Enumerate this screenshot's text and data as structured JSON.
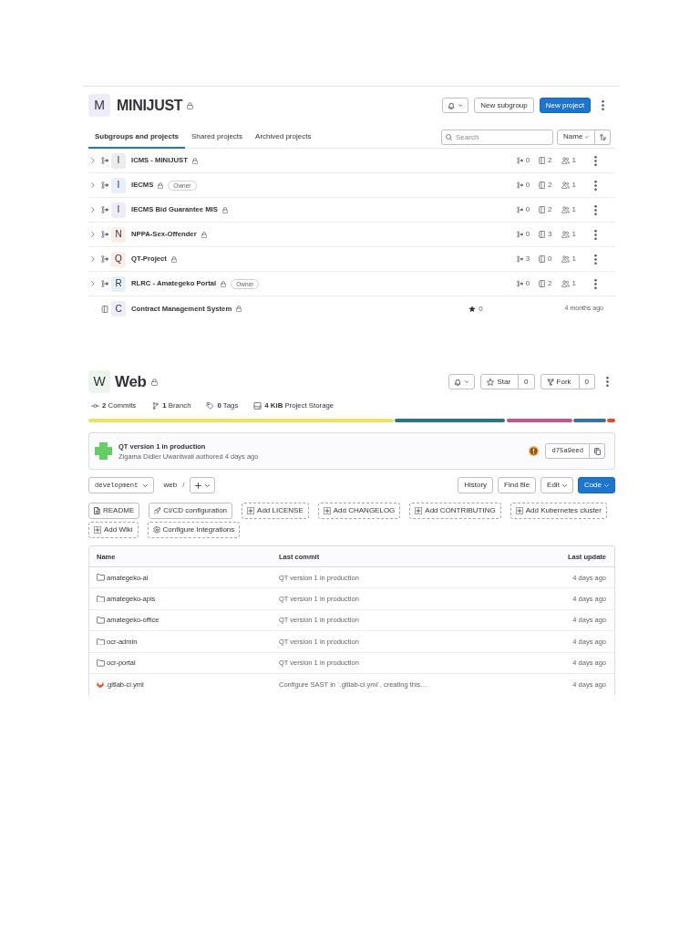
{
  "group": {
    "avatar": {
      "letter": "M",
      "color": "#eeecf8"
    },
    "name": "MINIJUST",
    "private": true,
    "buttons": [
      {
        "label": "New subgroup",
        "kind": "secondary"
      },
      {
        "label": "New project",
        "kind": "primary"
      }
    ],
    "tabs": [
      {
        "label": "Subgroups and projects",
        "selected": true
      },
      {
        "label": "Shared projects",
        "selected": false
      },
      {
        "label": "Archived projects",
        "selected": false
      }
    ],
    "search": {
      "placeholder": "Search"
    },
    "sort": {
      "label": "Name"
    },
    "items": [
      {
        "kind": "group",
        "letter": "I",
        "color": "#ececef",
        "name": "ICMS - MINIJUST",
        "private": true,
        "subgroups": "0",
        "projects": "2",
        "members": "1"
      },
      {
        "kind": "group",
        "letter": "I",
        "color": "#e6effa",
        "name": "IECMS",
        "private": true,
        "badge": "Owner",
        "subgroups": "0",
        "projects": "2",
        "members": "1"
      },
      {
        "kind": "group",
        "letter": "I",
        "color": "#eeecf8",
        "name": "IECMS Bid Guarantee MIS",
        "private": true,
        "subgroups": "0",
        "projects": "2",
        "members": "1"
      },
      {
        "kind": "group",
        "letter": "N",
        "color": "#fcede8",
        "name": "NPPA-Sex-Offender",
        "private": true,
        "subgroups": "0",
        "projects": "3",
        "members": "1"
      },
      {
        "kind": "group",
        "letter": "Q",
        "color": "#fcede8",
        "name": "QT-Project",
        "private": true,
        "subgroups": "3",
        "projects": "0",
        "members": "1"
      },
      {
        "kind": "group",
        "letter": "R",
        "color": "#e6effa",
        "name": "RLRC - Amategeko Portal",
        "private": true,
        "badge": "Owner",
        "subgroups": "0",
        "projects": "2",
        "members": "1"
      },
      {
        "kind": "project",
        "letter": "C",
        "color": "#eeecf8",
        "name": "Contract Management System",
        "private": true,
        "star_count": "0",
        "updated": "4 months ago"
      }
    ]
  },
  "project": {
    "avatar": {
      "letter": "W",
      "color": "#ecf4ee"
    },
    "name": "Web",
    "private": true,
    "social": [
      {
        "kind": "star",
        "label": "Star",
        "count": "0"
      },
      {
        "kind": "fork",
        "label": "Fork",
        "count": "0"
      }
    ],
    "stats": [
      {
        "kind": "commits",
        "text": "**2** Commits"
      },
      {
        "kind": "branches",
        "text": "**1** Branch"
      },
      {
        "kind": "tags",
        "text": "**0** Tags"
      },
      {
        "kind": "storage",
        "text": "**4 KiB** Project Storage"
      }
    ],
    "languages": [
      {
        "color": "#f1e05a"
      },
      {
        "color": "#2b7489"
      },
      {
        "color": "#c6538c"
      },
      {
        "color": "#3572a5"
      },
      {
        "color": "#e34c26"
      }
    ],
    "commit": {
      "title": "QT version 1 in production",
      "byline": "Zigama Didier Uwantwali authored 4 days ago",
      "sha": "d75a9eed"
    },
    "toolbar": {
      "branch": "development",
      "path": "web",
      "separator": "/",
      "actions": [
        {
          "label": "History",
          "kind": "plain"
        },
        {
          "label": "Find file",
          "kind": "plain"
        },
        {
          "label": "Edit",
          "kind": "menu"
        },
        {
          "label": "Code",
          "kind": "primary"
        }
      ]
    },
    "shortcuts": [
      {
        "label": "README",
        "kind": "readme"
      },
      {
        "label": "CI/CD configuration",
        "kind": "cicd"
      },
      {
        "label": "Add LICENSE",
        "kind": "add"
      },
      {
        "label": "Add CHANGELOG",
        "kind": "add"
      },
      {
        "label": "Add CONTRIBUTING",
        "kind": "add"
      },
      {
        "label": "Add Kubernetes cluster",
        "kind": "add"
      },
      {
        "label": "Add Wiki",
        "kind": "add"
      },
      {
        "label": "Configure Integrations",
        "kind": "configure"
      }
    ],
    "files": {
      "columns": [
        "Name",
        "Last commit",
        "Last update"
      ],
      "rows": [
        {
          "kind": "folder",
          "name": "amategeko-ai",
          "commit": "QT version 1 in production",
          "updated": "4 days ago"
        },
        {
          "kind": "folder",
          "name": "amategeko-apis",
          "commit": "QT version 1 in production",
          "updated": "4 days ago"
        },
        {
          "kind": "folder",
          "name": "amategeko-office",
          "commit": "QT version 1 in production",
          "updated": "4 days ago"
        },
        {
          "kind": "folder",
          "name": "ocr-admin",
          "commit": "QT version 1 in production",
          "updated": "4 days ago"
        },
        {
          "kind": "folder",
          "name": "ocr-portal",
          "commit": "QT version 1 in production",
          "updated": "4 days ago"
        },
        {
          "kind": "config",
          "name": ".gitlab-ci.yml",
          "commit": "Configure SAST in `.gitlab-ci.yml`, creating this…",
          "updated": "4 days ago"
        }
      ]
    }
  }
}
